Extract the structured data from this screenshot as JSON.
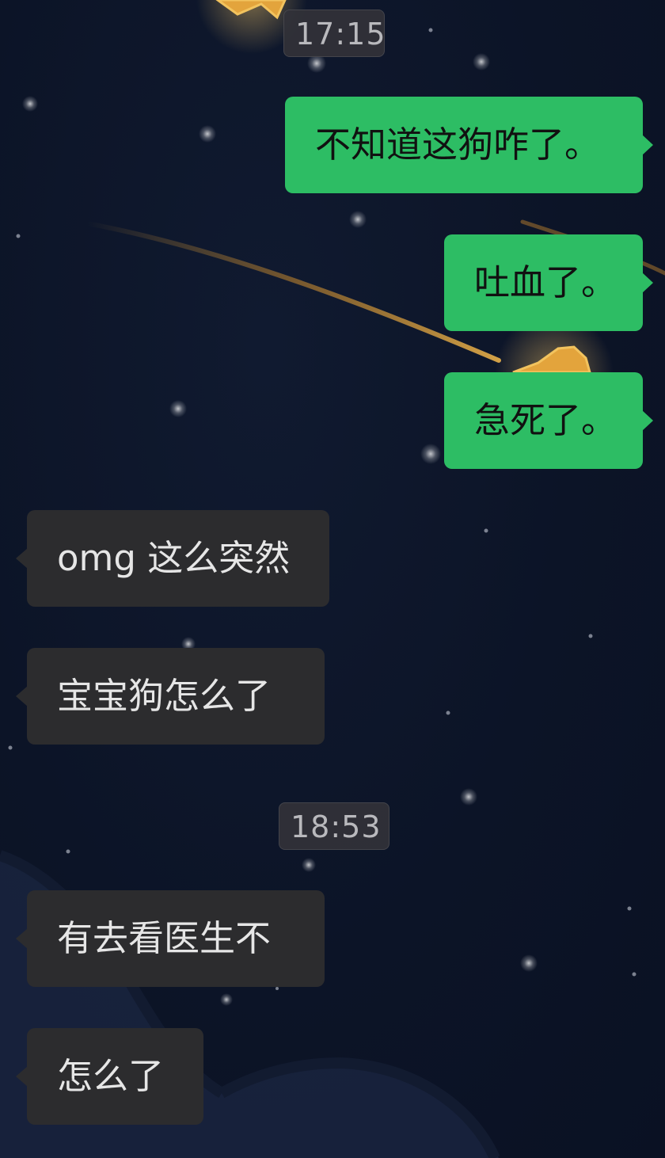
{
  "colors": {
    "background": "#0c1427",
    "outgoing_bubble": "#2dbd64",
    "incoming_bubble": "#2c2c2e",
    "timestamp_bg": "#323238",
    "star_glow": "#e0a23a"
  },
  "timestamps": [
    "17:15",
    "18:53"
  ],
  "messages": [
    {
      "direction": "outgoing",
      "text": "不知道这狗咋了。"
    },
    {
      "direction": "outgoing",
      "text": "吐血了。"
    },
    {
      "direction": "outgoing",
      "text": "急死了。"
    },
    {
      "direction": "incoming",
      "text": "omg 这么突然"
    },
    {
      "direction": "incoming",
      "text": "宝宝狗怎么了"
    },
    {
      "direction": "incoming",
      "text": "有去看医生不"
    },
    {
      "direction": "incoming",
      "text": "怎么了"
    }
  ]
}
